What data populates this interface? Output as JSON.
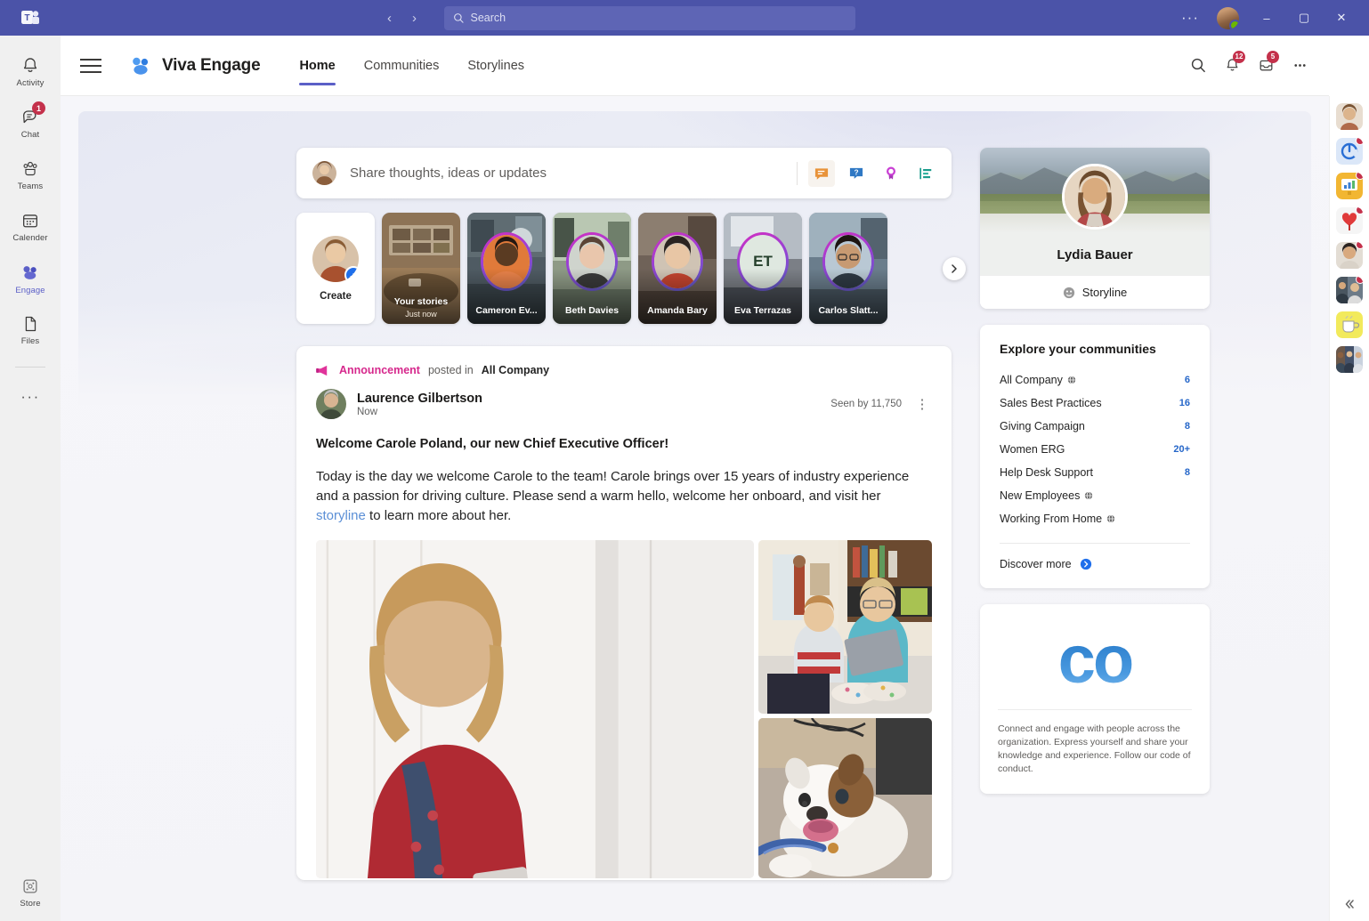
{
  "titlebar": {
    "app_icon": "teams-logo-icon",
    "nav_back": "‹",
    "nav_forward": "›",
    "search_placeholder": "Search",
    "more_options": "···",
    "minimize": "–",
    "maximize": "▢",
    "close": "✕",
    "presence": "available"
  },
  "left_rail": {
    "items": [
      {
        "label": "Activity",
        "icon": "bell-icon",
        "badge": "",
        "active": false
      },
      {
        "label": "Chat",
        "icon": "chat-icon",
        "badge": "1",
        "active": false
      },
      {
        "label": "Teams",
        "icon": "teams-people-icon",
        "badge": "",
        "active": false
      },
      {
        "label": "Calender",
        "icon": "calendar-icon",
        "badge": "",
        "active": false
      },
      {
        "label": "Engage",
        "icon": "engage-icon",
        "badge": "",
        "active": true
      },
      {
        "label": "Files",
        "icon": "files-icon",
        "badge": "",
        "active": false
      }
    ],
    "more": "···",
    "store": {
      "label": "Store",
      "icon": "store-icon"
    }
  },
  "engage_header": {
    "menu_icon": "hamburger-icon",
    "logo_icon": "viva-engage-logo-icon",
    "title": "Viva Engage",
    "tabs": [
      {
        "label": "Home",
        "active": true
      },
      {
        "label": "Communities",
        "active": false
      },
      {
        "label": "Storylines",
        "active": false
      }
    ],
    "actions": [
      {
        "icon": "search-icon",
        "badge": ""
      },
      {
        "icon": "bell-icon",
        "badge": "12"
      },
      {
        "icon": "inbox-icon",
        "badge": "5"
      },
      {
        "icon": "more-icon",
        "badge": ""
      }
    ]
  },
  "composer": {
    "placeholder": "Share thoughts, ideas or updates",
    "avatar": "user-avatar",
    "buttons": [
      {
        "name": "discussion-icon",
        "label": "Discussion",
        "color": "#e8933a",
        "selected": true
      },
      {
        "name": "question-icon",
        "label": "Question",
        "color": "#2f78c4",
        "selected": false
      },
      {
        "name": "praise-icon",
        "label": "Praise",
        "color": "#a435b5",
        "selected": false
      },
      {
        "name": "poll-icon",
        "label": "Poll",
        "color": "#1a9c8c",
        "selected": false
      }
    ]
  },
  "stories": {
    "create_label": "Create",
    "next_icon": "chevron-right-icon",
    "items": [
      {
        "name": "Your stories",
        "sub": "Just now",
        "initials": "",
        "ring": false
      },
      {
        "name": "Cameron Ev...",
        "sub": "",
        "initials": "",
        "ring": true
      },
      {
        "name": "Beth Davies",
        "sub": "",
        "initials": "",
        "ring": true
      },
      {
        "name": "Amanda Bary",
        "sub": "",
        "initials": "",
        "ring": true
      },
      {
        "name": "Eva Terrazas",
        "sub": "",
        "initials": "ET",
        "ring": true
      },
      {
        "name": "Carlos Slatt...",
        "sub": "",
        "initials": "",
        "ring": true
      }
    ]
  },
  "post": {
    "badge_icon": "announcement-megaphone-icon",
    "badge_label": "Announcement",
    "posted_in_label": "posted in",
    "community": "All Company",
    "author": "Laurence Gilbertson",
    "time": "Now",
    "seen_by": "Seen by 11,750",
    "kebab": "⋮",
    "title": "Welcome Carole Poland, our new Chief Executive Officer!",
    "body_before": "Today is the day we welcome Carole to the team! Carole brings over 15 years of industry experience and a passion for driving culture. Please send a warm hello, welcome her onboard, and visit her ",
    "body_link": "storyline",
    "body_after": " to learn more about her.",
    "images": [
      {
        "alt": "woman-in-red-cardigan-photo"
      },
      {
        "alt": "mother-and-son-with-tablet-photo"
      },
      {
        "alt": "bulldog-with-leash-photo"
      }
    ]
  },
  "profile_card": {
    "name": "Lydia Bauer",
    "storyline_label": "Storyline",
    "storyline_icon": "storyline-icon",
    "banner_alt": "mountain-landscape-banner"
  },
  "communities": {
    "title": "Explore your communities",
    "items": [
      {
        "name": "All Company",
        "count": "6",
        "public": true
      },
      {
        "name": "Sales Best Practices",
        "count": "16",
        "public": false
      },
      {
        "name": "Giving Campaign",
        "count": "8",
        "public": false
      },
      {
        "name": "Women ERG",
        "count": "20+",
        "public": false
      },
      {
        "name": "Help Desk Support",
        "count": "8",
        "public": false
      },
      {
        "name": "New Employees",
        "count": "",
        "public": true
      },
      {
        "name": "Working From Home",
        "count": "",
        "public": true
      }
    ],
    "discover_label": "Discover more",
    "discover_icon": "arrow-right-circle-icon"
  },
  "co_card": {
    "logo_text": "co",
    "description": "Connect and engage with people across the organization. Express yourself and share your knowledge and experience. Follow our code of conduct."
  },
  "app_rail": {
    "tiles": [
      {
        "name": "avatar-tile",
        "badge": false
      },
      {
        "name": "viva-connections-icon",
        "badge": true
      },
      {
        "name": "viva-insights-icon",
        "badge": true
      },
      {
        "name": "praise-heart-icon",
        "badge": true
      },
      {
        "name": "person-photo-tile",
        "badge": true
      },
      {
        "name": "meeting-photo-tile",
        "badge": true
      },
      {
        "name": "coffee-icon",
        "badge": false
      },
      {
        "name": "group-photo-tile",
        "badge": false
      }
    ],
    "collapse_icon": "chevron-double-left-icon"
  },
  "colors": {
    "teams_purple": "#4b53a8",
    "accent": "#5b5fc7",
    "badge_red": "#c4314b",
    "announcement_pink": "#d6288c",
    "link_blue": "#5b8fd6",
    "count_blue": "#2667c9"
  }
}
